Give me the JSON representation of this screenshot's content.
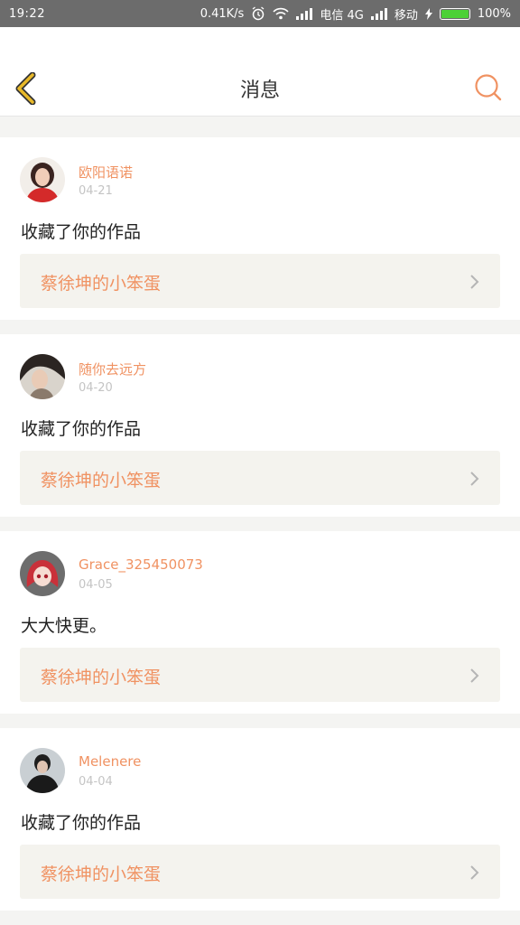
{
  "status_bar": {
    "time": "19:22",
    "speed": "0.41K/s",
    "carrier1": "电信 4G",
    "carrier2": "移动",
    "battery": "100%",
    "icons": [
      "alarm-icon",
      "wifi-icon",
      "signal-icon",
      "charging-icon",
      "battery-icon"
    ]
  },
  "header": {
    "title": "消息",
    "back_icon": "chevron-left-icon",
    "search_icon": "search-icon"
  },
  "colors": {
    "accent": "#f09262",
    "back": "#e8b92a",
    "card_bg": "#ffffff",
    "work_bg": "#f4f3ee"
  },
  "messages": [
    {
      "username": "欧阳语诺",
      "date": "04-21",
      "text": "收藏了你的作品",
      "work_title": "蔡徐坤的小笨蛋"
    },
    {
      "username": "随你去远方",
      "date": "04-20",
      "text": "收藏了你的作品",
      "work_title": "蔡徐坤的小笨蛋"
    },
    {
      "username": "Grace_325450073",
      "date": "04-05",
      "text": "大大快更。",
      "work_title": "蔡徐坤的小笨蛋"
    },
    {
      "username": "Melenere",
      "date": "04-04",
      "text": "收藏了你的作品",
      "work_title": "蔡徐坤的小笨蛋"
    }
  ]
}
